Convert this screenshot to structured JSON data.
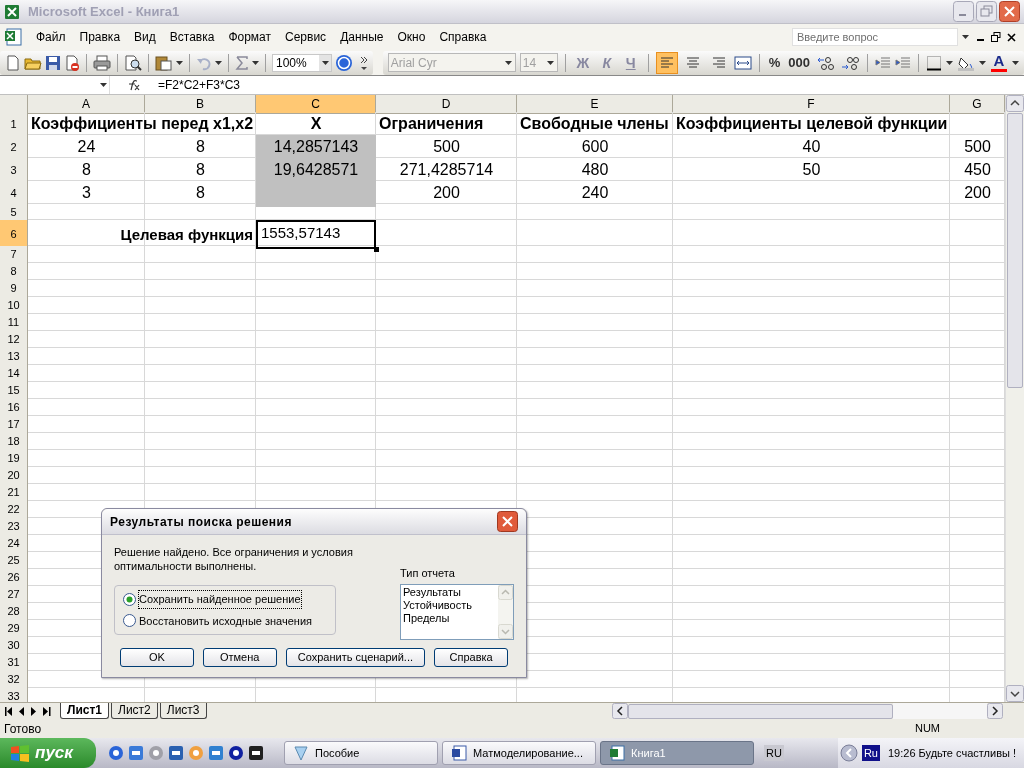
{
  "window": {
    "title": "Microsoft Excel - Книга1"
  },
  "menu": [
    "Файл",
    "Правка",
    "Вид",
    "Вставка",
    "Формат",
    "Сервис",
    "Данные",
    "Окно",
    "Справка"
  ],
  "help_search": {
    "placeholder": "Введите вопрос"
  },
  "standard_toolbar": {
    "zoom": "100%"
  },
  "formatting_toolbar": {
    "font": "Arial Cyr",
    "size": "14",
    "style_buttons": [
      "Ж",
      "К",
      "Ч"
    ],
    "align_buttons": [
      {
        "selected": true
      },
      {
        "selected": false
      },
      {
        "selected": false
      }
    ],
    "number_buttons": [
      "%",
      "000"
    ],
    "font_color_button": "A"
  },
  "formula_bar": {
    "formula": "=F2*C2+F3*C3"
  },
  "columns": [
    {
      "label": "A",
      "selected": false
    },
    {
      "label": "B",
      "selected": false
    },
    {
      "label": "C",
      "selected": true
    },
    {
      "label": "D",
      "selected": false
    },
    {
      "label": "E",
      "selected": false
    },
    {
      "label": "F",
      "selected": false
    },
    {
      "label": "G",
      "selected": false
    }
  ],
  "rows": [
    {
      "number": "1",
      "selected": false,
      "cells": [
        {
          "text": "Коэффициенты перед x1,x2",
          "shaded": false,
          "selected": false
        },
        null,
        {
          "text": "X",
          "shaded": false,
          "selected": false
        },
        {
          "text": "Ограничения",
          "shaded": false,
          "selected": false
        },
        {
          "text": "Свободные члены",
          "shaded": false,
          "selected": false
        },
        {
          "text": "Коэффициенты целевой функции",
          "shaded": false,
          "selected": false
        },
        null
      ]
    },
    {
      "number": "2",
      "selected": false,
      "cells": [
        {
          "text": "24",
          "shaded": false,
          "selected": false
        },
        {
          "text": "8",
          "shaded": false,
          "selected": false
        },
        {
          "text": "14,2857143",
          "shaded": true,
          "selected": false
        },
        {
          "text": "500",
          "shaded": false,
          "selected": false
        },
        {
          "text": "600",
          "shaded": false,
          "selected": false
        },
        {
          "text": "40",
          "shaded": false,
          "selected": false
        },
        {
          "text": "500",
          "shaded": false,
          "selected": false
        }
      ]
    },
    {
      "number": "3",
      "selected": false,
      "cells": [
        {
          "text": "8",
          "shaded": false,
          "selected": false
        },
        {
          "text": "8",
          "shaded": false,
          "selected": false
        },
        {
          "text": "19,6428571",
          "shaded": true,
          "selected": false
        },
        {
          "text": "271,4285714",
          "shaded": false,
          "selected": false
        },
        {
          "text": "480",
          "shaded": false,
          "selected": false
        },
        {
          "text": "50",
          "shaded": false,
          "selected": false
        },
        {
          "text": "450",
          "shaded": false,
          "selected": false
        }
      ]
    },
    {
      "number": "4",
      "selected": false,
      "cells": [
        {
          "text": "3",
          "shaded": false,
          "selected": false
        },
        {
          "text": "8",
          "shaded": false,
          "selected": false
        },
        {
          "shaded": true,
          "selected": false
        },
        {
          "text": "200",
          "shaded": false,
          "selected": false
        },
        {
          "text": "240",
          "shaded": false,
          "selected": false
        },
        null,
        {
          "text": "200",
          "shaded": false,
          "selected": false
        }
      ]
    },
    {
      "number": "5",
      "selected": false
    },
    {
      "number": "6",
      "selected": true,
      "cells": [
        null,
        {
          "text": "Целевая функция",
          "shaded": false,
          "selected": false
        },
        {
          "text": "1553,57143",
          "shaded": false,
          "selected": true
        },
        null,
        null,
        null,
        null
      ]
    },
    {
      "number": "7",
      "selected": false
    },
    {
      "number": "8",
      "selected": false
    },
    {
      "number": "9",
      "selected": false
    },
    {
      "number": "10",
      "selected": false
    },
    {
      "number": "11",
      "selected": false
    },
    {
      "number": "12",
      "selected": false
    },
    {
      "number": "13",
      "selected": false
    },
    {
      "number": "14",
      "selected": false
    },
    {
      "number": "15",
      "selected": false
    },
    {
      "number": "16",
      "selected": false
    },
    {
      "number": "17",
      "selected": false
    },
    {
      "number": "18",
      "selected": false
    },
    {
      "number": "19",
      "selected": false
    },
    {
      "number": "20",
      "selected": false
    },
    {
      "number": "21",
      "selected": false
    },
    {
      "number": "22",
      "selected": false
    },
    {
      "number": "23",
      "selected": false
    },
    {
      "number": "24",
      "selected": false
    },
    {
      "number": "25",
      "selected": false
    },
    {
      "number": "26",
      "selected": false
    },
    {
      "number": "27",
      "selected": false
    },
    {
      "number": "28",
      "selected": false
    },
    {
      "number": "29",
      "selected": false
    },
    {
      "number": "30",
      "selected": false
    },
    {
      "number": "31",
      "selected": false
    },
    {
      "number": "32",
      "selected": false
    },
    {
      "number": "33",
      "selected": false
    }
  ],
  "sheet_tabs": [
    {
      "label": "Лист1",
      "selected": true
    },
    {
      "label": "Лист2",
      "selected": false
    },
    {
      "label": "Лист3",
      "selected": false
    }
  ],
  "status_bar": {
    "status": "Готово",
    "indicator": "NUM"
  },
  "dialog": {
    "title": "Результаты поиска решения",
    "message": "Решение найдено. Все ограничения и условия оптимальности выполнены.",
    "options": [
      {
        "label": "Сохранить найденное решение",
        "selected": true
      },
      {
        "label": "Восстановить исходные значения",
        "selected": false
      }
    ],
    "report_label": "Тип отчета",
    "reports": [
      "Результаты",
      "Устойчивость",
      "Пределы"
    ],
    "buttons": [
      "OK",
      "Отмена",
      "Сохранить сценарий...",
      "Справка"
    ]
  },
  "taskbar": {
    "start": "пуск",
    "tasks": [
      {
        "label": "Пособие",
        "selected": false
      },
      {
        "label": "Матмоделирование...",
        "selected": false
      },
      {
        "label": "Книга1",
        "selected": true
      }
    ],
    "language": "RU",
    "tray_language": "Ru",
    "clock": "19:26 Будьте счастливы !"
  }
}
